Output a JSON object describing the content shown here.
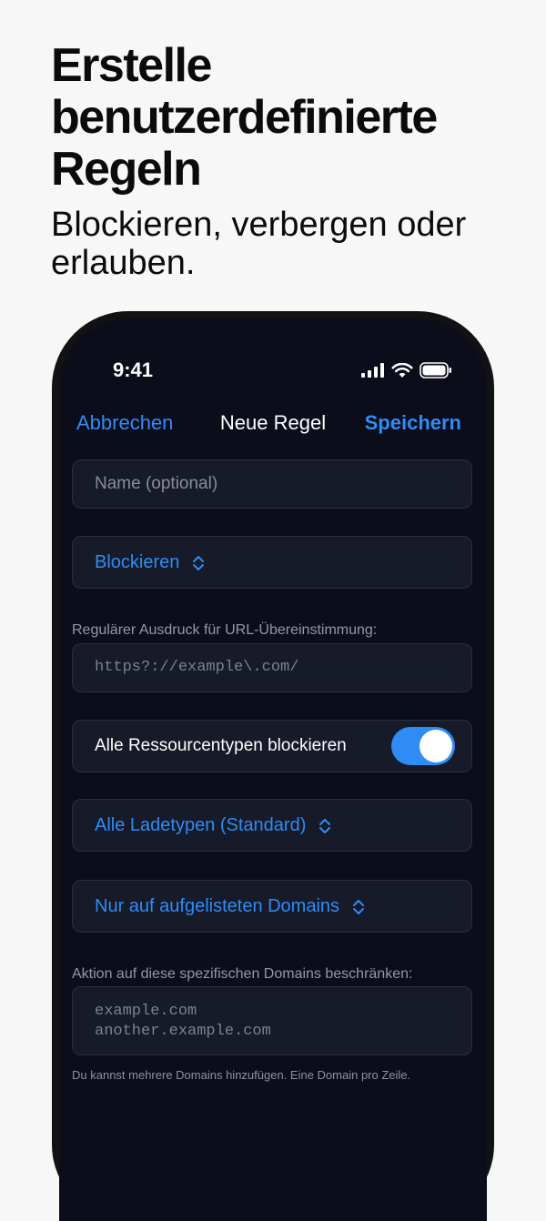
{
  "promo": {
    "headline_lines": [
      "Erstelle",
      "benutzerdefinierte",
      "Regeln"
    ],
    "subline_lines": [
      "Blockieren, verbergen oder",
      "erlauben."
    ]
  },
  "status_bar": {
    "time": "9:41",
    "icons": [
      "signal-icon",
      "wifi-icon",
      "battery-icon"
    ]
  },
  "nav": {
    "cancel_label": "Abbrechen",
    "title": "Neue Regel",
    "save_label": "Speichern"
  },
  "form": {
    "name_placeholder": "Name (optional)",
    "action_select": "Blockieren",
    "regex_label": "Regulärer Ausdruck für URL-Übereinstimmung:",
    "regex_placeholder": "https?://example\\.com/",
    "all_resources_label": "Alle Ressourcentypen blockieren",
    "all_resources_on": true,
    "load_type_select": "Alle Ladetypen (Standard)",
    "domain_mode_select": "Nur auf aufgelisteten Domains",
    "domains_label": "Aktion auf diese spezifischen Domains beschränken:",
    "domains_placeholder_lines": [
      "example.com",
      "another.example.com"
    ],
    "domains_hint": "Du kannst mehrere Domains hinzufügen. Eine Domain pro Zeile."
  },
  "colors": {
    "accent": "#2f8cf5",
    "screen_bg": "#0b0d1a",
    "field_bg": "#161a29",
    "page_bg": "#f7f7f8"
  }
}
